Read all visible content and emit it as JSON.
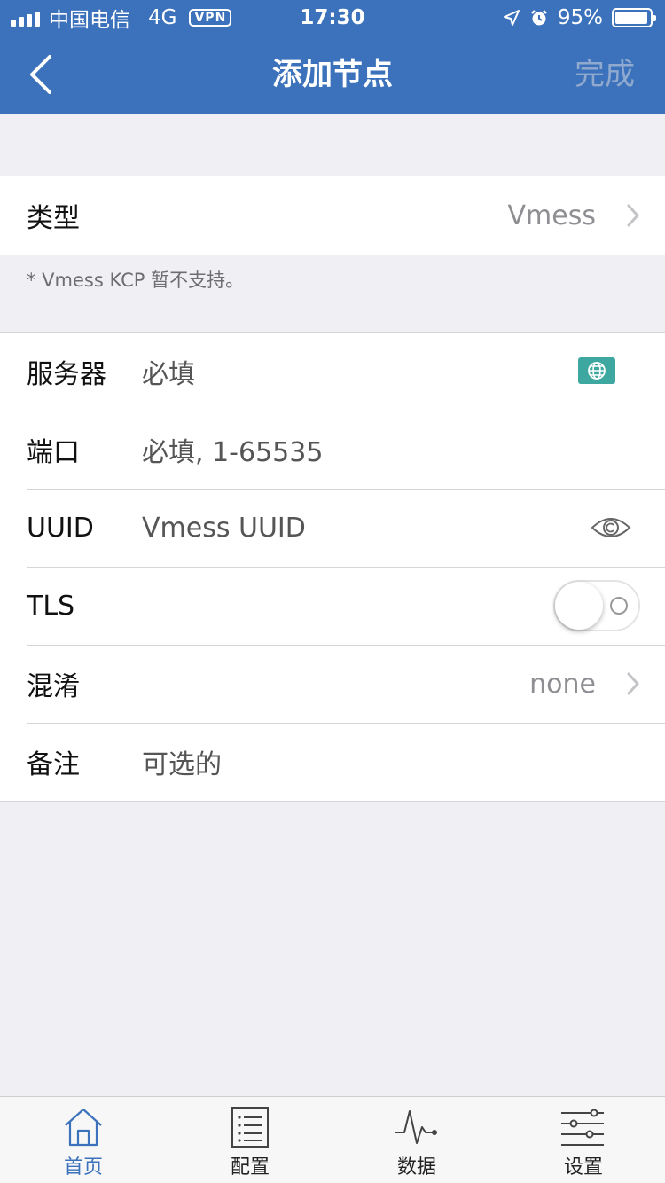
{
  "status_bar": {
    "carrier": "中国电信",
    "network": "4G",
    "vpn": "VPN",
    "time": "17:30",
    "battery": "95%",
    "battery_level": 0.95
  },
  "nav": {
    "title": "添加节点",
    "done": "完成"
  },
  "type_row": {
    "label": "类型",
    "value": "Vmess"
  },
  "type_note": "* Vmess KCP 暂不支持。",
  "form": {
    "server": {
      "label": "服务器",
      "placeholder": "必填"
    },
    "port": {
      "label": "端口",
      "placeholder": "必填, 1-65535"
    },
    "uuid": {
      "label": "UUID",
      "placeholder": "Vmess UUID"
    },
    "tls": {
      "label": "TLS",
      "enabled": false
    },
    "obfs": {
      "label": "混淆",
      "value": "none"
    },
    "remark": {
      "label": "备注",
      "placeholder": "可选的"
    }
  },
  "tabs": [
    {
      "label": "首页",
      "icon": "home-icon",
      "active": true
    },
    {
      "label": "配置",
      "icon": "list-icon",
      "active": false
    },
    {
      "label": "数据",
      "icon": "pulse-icon",
      "active": false
    },
    {
      "label": "设置",
      "icon": "sliders-icon",
      "active": false
    }
  ],
  "colors": {
    "accent": "#3c72bb",
    "globe_button": "#3ea8a0",
    "background": "#efeff4"
  }
}
